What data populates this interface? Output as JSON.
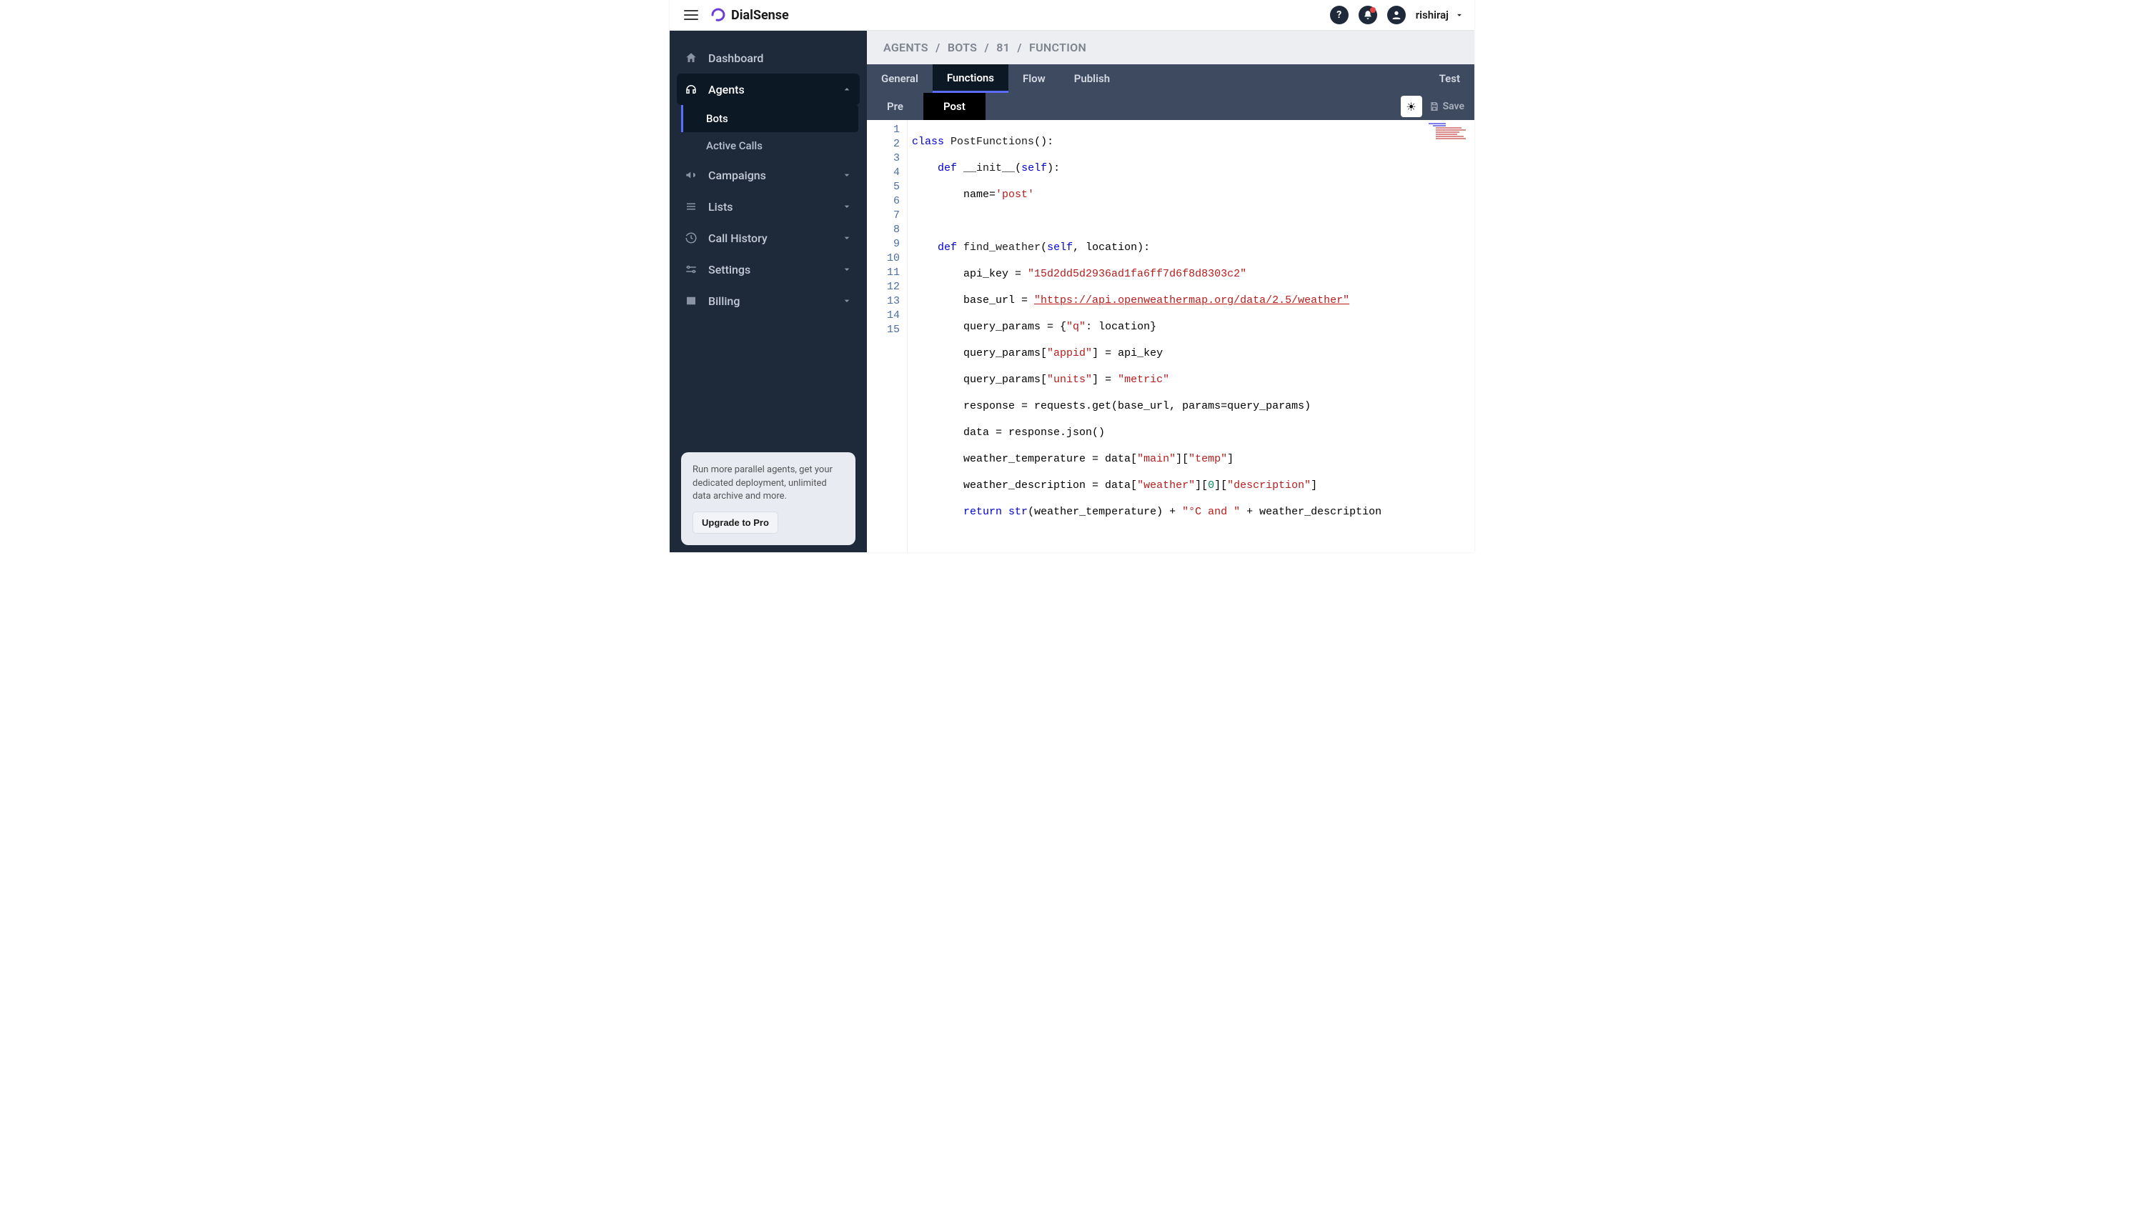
{
  "brand": "DialSense",
  "user": {
    "name": "rishiraj"
  },
  "sidebar": {
    "items": [
      {
        "label": "Dashboard"
      },
      {
        "label": "Agents",
        "expanded": true
      },
      {
        "label": "Campaigns"
      },
      {
        "label": "Lists"
      },
      {
        "label": "Call History"
      },
      {
        "label": "Settings"
      },
      {
        "label": "Billing"
      }
    ],
    "sub_agents": [
      {
        "label": "Bots"
      },
      {
        "label": "Active Calls"
      }
    ]
  },
  "promo": {
    "text": "Run more parallel agents, get your dedicated deployment, unlimited data archive and more.",
    "button": "Upgrade to Pro"
  },
  "breadcrumb": [
    "AGENTS",
    "BOTS",
    "81",
    "FUNCTION"
  ],
  "tabs": {
    "items": [
      "General",
      "Functions",
      "Flow",
      "Publish"
    ],
    "right": "Test",
    "active": "Functions"
  },
  "subtabs": {
    "items": [
      "Pre",
      "Post"
    ],
    "active": "Post"
  },
  "toolbar": {
    "save": "Save"
  },
  "code": {
    "line_count": 15,
    "tokens": {
      "class": "class",
      "def": "def",
      "self": "self",
      "return": "return",
      "str_fn": "str",
      "cls_name": "PostFunctions",
      "init": "__init__",
      "name_eq": "name=",
      "post_str": "'post'",
      "find_weather": "find_weather",
      "location": "location",
      "api_key_var": "api_key = ",
      "api_key_val": "\"15d2dd5d2936ad1fa6ff7d6f8d8303c2\"",
      "base_url_var": "base_url = ",
      "base_url_val": "\"https://api.openweathermap.org/data/2.5/weather\"",
      "qp": "query_params = {",
      "q": "\"q\"",
      "qp_loc": ": location}",
      "qp_appid_l": "query_params[",
      "appid": "\"appid\"",
      "qp_appid_r": "] = api_key",
      "units": "\"units\"",
      "metric": "\"metric\"",
      "eq_resp": "response = requests.get(base_url, params=query_params)",
      "eq_data": "data = response.json()",
      "wt_var": "weather_temperature = data[",
      "main": "\"main\"",
      "temp": "\"temp\"",
      "wd_var": "weather_description = data[",
      "weather": "\"weather\"",
      "zero": "0",
      "desc": "\"description\"",
      "ret_mid": "(weather_temperature) + ",
      "c_and": "\"°C and \"",
      "ret_tail": " + weather_description"
    }
  }
}
